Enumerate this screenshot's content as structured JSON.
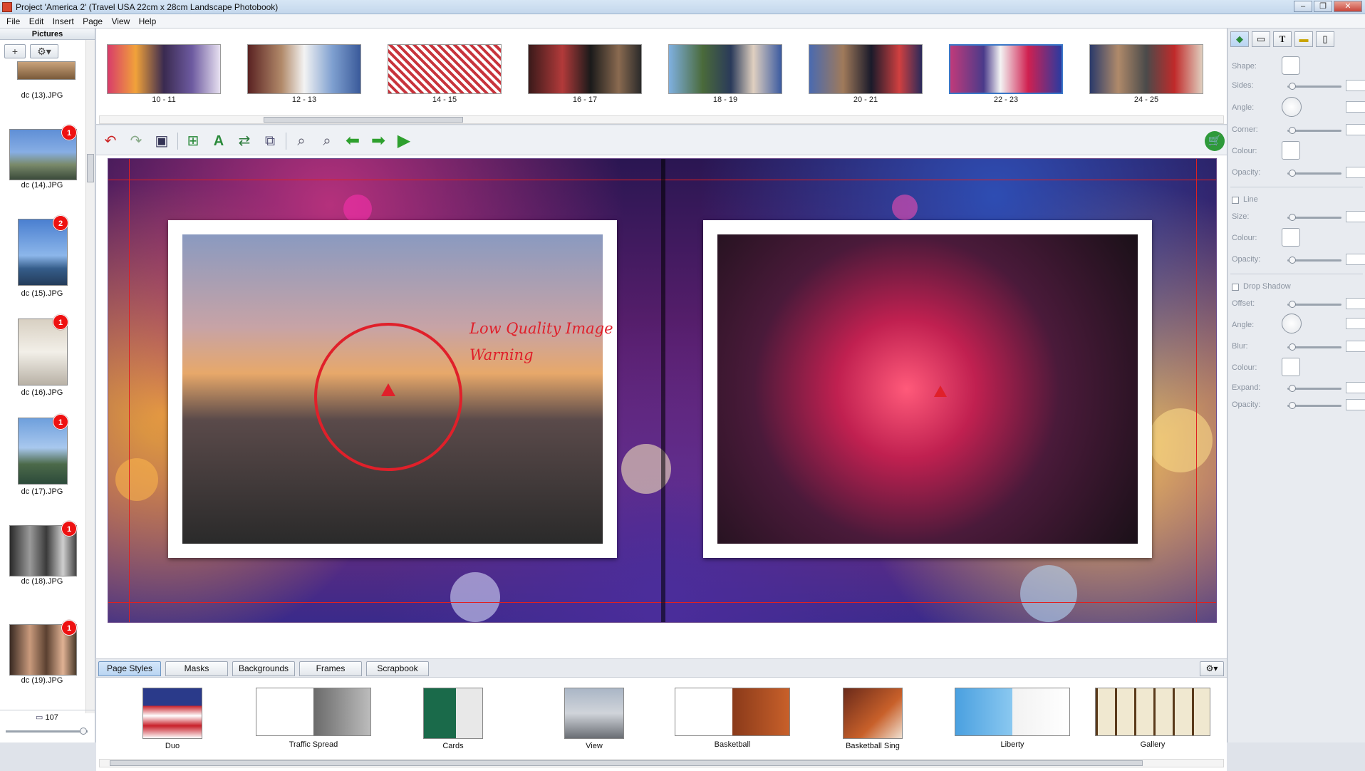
{
  "window": {
    "title": "Project 'America 2' (Travel USA 22cm x 28cm Landscape Photobook)"
  },
  "menu": [
    "File",
    "Edit",
    "Insert",
    "Page",
    "View",
    "Help"
  ],
  "pictures": {
    "header": "Pictures",
    "add_label": "+",
    "items": [
      {
        "label": "dc (13).JPG",
        "badge": ""
      },
      {
        "label": "dc (14).JPG",
        "badge": "1"
      },
      {
        "label": "dc (15).JPG",
        "badge": "2"
      },
      {
        "label": "dc (16).JPG",
        "badge": "1"
      },
      {
        "label": "dc (17).JPG",
        "badge": "1"
      },
      {
        "label": "dc (18).JPG",
        "badge": "1"
      },
      {
        "label": "dc (19).JPG",
        "badge": "1"
      }
    ],
    "count": "107"
  },
  "pages": [
    {
      "label": "10 - 11",
      "selected": false
    },
    {
      "label": "12 - 13",
      "selected": false
    },
    {
      "label": "14 - 15",
      "selected": false
    },
    {
      "label": "16 - 17",
      "selected": false
    },
    {
      "label": "18 - 19",
      "selected": false
    },
    {
      "label": "20 - 21",
      "selected": false
    },
    {
      "label": "22 - 23",
      "selected": true
    },
    {
      "label": "24 - 25",
      "selected": false
    }
  ],
  "spread": {
    "warning_line1": "Low Quality Image",
    "warning_line2": "Warning",
    "warning_color": "#e0202a"
  },
  "tabs": [
    {
      "label": "Page Styles",
      "active": true
    },
    {
      "label": "Masks",
      "active": false
    },
    {
      "label": "Backgrounds",
      "active": false
    },
    {
      "label": "Frames",
      "active": false
    },
    {
      "label": "Scrapbook",
      "active": false
    }
  ],
  "styles": [
    {
      "label": "Duo"
    },
    {
      "label": "Traffic Spread"
    },
    {
      "label": "Cards"
    },
    {
      "label": "View"
    },
    {
      "label": "Basketball"
    },
    {
      "label": "Basketball Sing"
    },
    {
      "label": "Liberty"
    },
    {
      "label": "Gallery"
    }
  ],
  "props": {
    "shape": "Shape:",
    "sides": "Sides:",
    "angle": "Angle:",
    "corner": "Corner:",
    "colour": "Colour:",
    "opacity": "Opacity:",
    "line_header": "Line",
    "line_size": "Size:",
    "line_colour": "Colour:",
    "line_opacity": "Opacity:",
    "shadow_header": "Drop Shadow",
    "offset": "Offset:",
    "shadow_angle": "Angle:",
    "blur": "Blur:",
    "shadow_colour": "Colour:",
    "expand": "Expand:",
    "shadow_opacity": "Opacity:"
  }
}
